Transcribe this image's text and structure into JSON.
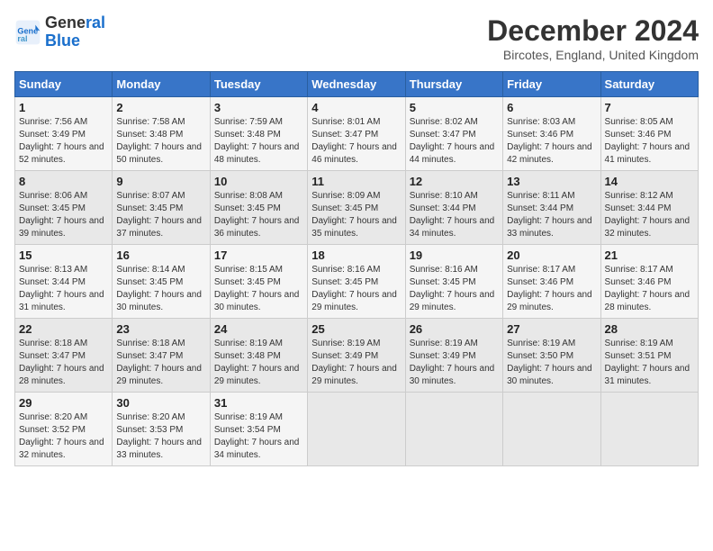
{
  "header": {
    "logo_line1": "General",
    "logo_line2": "Blue",
    "month": "December 2024",
    "location": "Bircotes, England, United Kingdom"
  },
  "days_of_week": [
    "Sunday",
    "Monday",
    "Tuesday",
    "Wednesday",
    "Thursday",
    "Friday",
    "Saturday"
  ],
  "weeks": [
    [
      {
        "day": "1",
        "sunrise": "Sunrise: 7:56 AM",
        "sunset": "Sunset: 3:49 PM",
        "daylight": "Daylight: 7 hours and 52 minutes."
      },
      {
        "day": "2",
        "sunrise": "Sunrise: 7:58 AM",
        "sunset": "Sunset: 3:48 PM",
        "daylight": "Daylight: 7 hours and 50 minutes."
      },
      {
        "day": "3",
        "sunrise": "Sunrise: 7:59 AM",
        "sunset": "Sunset: 3:48 PM",
        "daylight": "Daylight: 7 hours and 48 minutes."
      },
      {
        "day": "4",
        "sunrise": "Sunrise: 8:01 AM",
        "sunset": "Sunset: 3:47 PM",
        "daylight": "Daylight: 7 hours and 46 minutes."
      },
      {
        "day": "5",
        "sunrise": "Sunrise: 8:02 AM",
        "sunset": "Sunset: 3:47 PM",
        "daylight": "Daylight: 7 hours and 44 minutes."
      },
      {
        "day": "6",
        "sunrise": "Sunrise: 8:03 AM",
        "sunset": "Sunset: 3:46 PM",
        "daylight": "Daylight: 7 hours and 42 minutes."
      },
      {
        "day": "7",
        "sunrise": "Sunrise: 8:05 AM",
        "sunset": "Sunset: 3:46 PM",
        "daylight": "Daylight: 7 hours and 41 minutes."
      }
    ],
    [
      {
        "day": "8",
        "sunrise": "Sunrise: 8:06 AM",
        "sunset": "Sunset: 3:45 PM",
        "daylight": "Daylight: 7 hours and 39 minutes."
      },
      {
        "day": "9",
        "sunrise": "Sunrise: 8:07 AM",
        "sunset": "Sunset: 3:45 PM",
        "daylight": "Daylight: 7 hours and 37 minutes."
      },
      {
        "day": "10",
        "sunrise": "Sunrise: 8:08 AM",
        "sunset": "Sunset: 3:45 PM",
        "daylight": "Daylight: 7 hours and 36 minutes."
      },
      {
        "day": "11",
        "sunrise": "Sunrise: 8:09 AM",
        "sunset": "Sunset: 3:45 PM",
        "daylight": "Daylight: 7 hours and 35 minutes."
      },
      {
        "day": "12",
        "sunrise": "Sunrise: 8:10 AM",
        "sunset": "Sunset: 3:44 PM",
        "daylight": "Daylight: 7 hours and 34 minutes."
      },
      {
        "day": "13",
        "sunrise": "Sunrise: 8:11 AM",
        "sunset": "Sunset: 3:44 PM",
        "daylight": "Daylight: 7 hours and 33 minutes."
      },
      {
        "day": "14",
        "sunrise": "Sunrise: 8:12 AM",
        "sunset": "Sunset: 3:44 PM",
        "daylight": "Daylight: 7 hours and 32 minutes."
      }
    ],
    [
      {
        "day": "15",
        "sunrise": "Sunrise: 8:13 AM",
        "sunset": "Sunset: 3:44 PM",
        "daylight": "Daylight: 7 hours and 31 minutes."
      },
      {
        "day": "16",
        "sunrise": "Sunrise: 8:14 AM",
        "sunset": "Sunset: 3:45 PM",
        "daylight": "Daylight: 7 hours and 30 minutes."
      },
      {
        "day": "17",
        "sunrise": "Sunrise: 8:15 AM",
        "sunset": "Sunset: 3:45 PM",
        "daylight": "Daylight: 7 hours and 30 minutes."
      },
      {
        "day": "18",
        "sunrise": "Sunrise: 8:16 AM",
        "sunset": "Sunset: 3:45 PM",
        "daylight": "Daylight: 7 hours and 29 minutes."
      },
      {
        "day": "19",
        "sunrise": "Sunrise: 8:16 AM",
        "sunset": "Sunset: 3:45 PM",
        "daylight": "Daylight: 7 hours and 29 minutes."
      },
      {
        "day": "20",
        "sunrise": "Sunrise: 8:17 AM",
        "sunset": "Sunset: 3:46 PM",
        "daylight": "Daylight: 7 hours and 29 minutes."
      },
      {
        "day": "21",
        "sunrise": "Sunrise: 8:17 AM",
        "sunset": "Sunset: 3:46 PM",
        "daylight": "Daylight: 7 hours and 28 minutes."
      }
    ],
    [
      {
        "day": "22",
        "sunrise": "Sunrise: 8:18 AM",
        "sunset": "Sunset: 3:47 PM",
        "daylight": "Daylight: 7 hours and 28 minutes."
      },
      {
        "day": "23",
        "sunrise": "Sunrise: 8:18 AM",
        "sunset": "Sunset: 3:47 PM",
        "daylight": "Daylight: 7 hours and 29 minutes."
      },
      {
        "day": "24",
        "sunrise": "Sunrise: 8:19 AM",
        "sunset": "Sunset: 3:48 PM",
        "daylight": "Daylight: 7 hours and 29 minutes."
      },
      {
        "day": "25",
        "sunrise": "Sunrise: 8:19 AM",
        "sunset": "Sunset: 3:49 PM",
        "daylight": "Daylight: 7 hours and 29 minutes."
      },
      {
        "day": "26",
        "sunrise": "Sunrise: 8:19 AM",
        "sunset": "Sunset: 3:49 PM",
        "daylight": "Daylight: 7 hours and 30 minutes."
      },
      {
        "day": "27",
        "sunrise": "Sunrise: 8:19 AM",
        "sunset": "Sunset: 3:50 PM",
        "daylight": "Daylight: 7 hours and 30 minutes."
      },
      {
        "day": "28",
        "sunrise": "Sunrise: 8:19 AM",
        "sunset": "Sunset: 3:51 PM",
        "daylight": "Daylight: 7 hours and 31 minutes."
      }
    ],
    [
      {
        "day": "29",
        "sunrise": "Sunrise: 8:20 AM",
        "sunset": "Sunset: 3:52 PM",
        "daylight": "Daylight: 7 hours and 32 minutes."
      },
      {
        "day": "30",
        "sunrise": "Sunrise: 8:20 AM",
        "sunset": "Sunset: 3:53 PM",
        "daylight": "Daylight: 7 hours and 33 minutes."
      },
      {
        "day": "31",
        "sunrise": "Sunrise: 8:19 AM",
        "sunset": "Sunset: 3:54 PM",
        "daylight": "Daylight: 7 hours and 34 minutes."
      },
      null,
      null,
      null,
      null
    ]
  ]
}
